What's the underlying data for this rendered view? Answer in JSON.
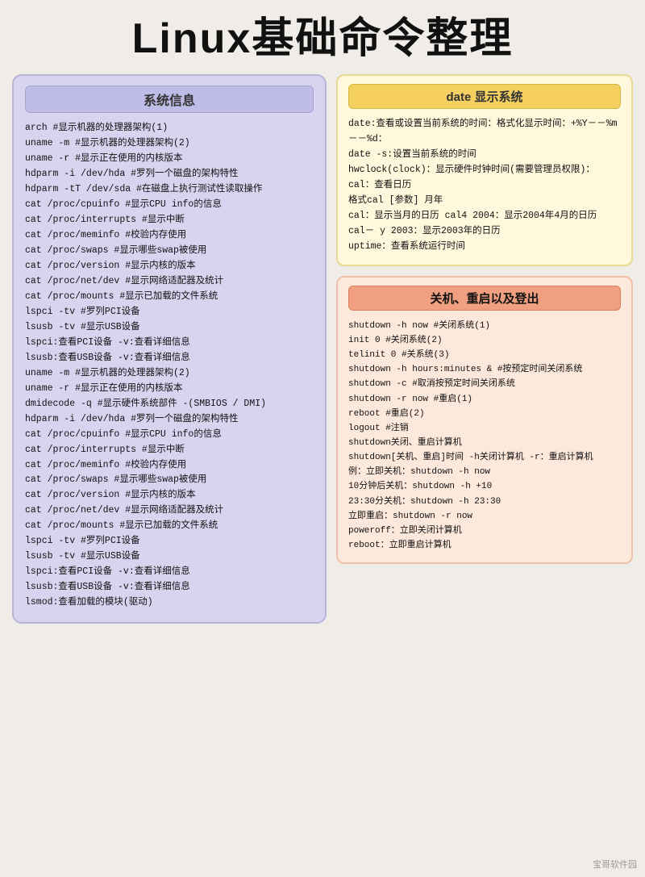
{
  "title": "Linux基础命令整理",
  "left_panel": {
    "header": "系统信息",
    "lines": [
      "arch      #显示机器的处理器架构(1)",
      "uname -m  #显示机器的处理器架构(2)",
      "uname -r  #显示正在使用的内核版本",
      "hdparm -i /dev/hda   #罗列一个磁盘的架构特性",
      "hdparm -tT /dev/sda  #在磁盘上执行测试性读取操作",
      "cat /proc/cpuinfo    #显示CPU info的信息",
      "cat /proc/interrupts #显示中断",
      "cat /proc/meminfo    #校验内存使用",
      "cat /proc/swaps      #显示哪些swap被使用",
      "cat /proc/version    #显示内核的版本",
      "cat /proc/net/dev    #显示网络适配器及统计",
      "cat /proc/mounts     #显示已加载的文件系统",
      "lspci -tv   #罗列PCI设备",
      "lsusb -tv   #显示USB设备",
      "lspci:查看PCI设备  -v:查看详细信息",
      "lsusb:查看USB设备  -v:查看详细信息",
      "uname -m  #显示机器的处理器架构(2)",
      "uname -r  #显示正在使用的内核版本",
      "dmidecode -q       #显示硬件系统部件 -(SMBIOS / DMI)",
      "hdparm -i /dev/hda   #罗列一个磁盘的架构特性",
      "cat /proc/cpuinfo    #显示CPU info的信息",
      "cat /proc/interrupts #显示中断",
      "cat /proc/meminfo    #校验内存使用",
      "cat /proc/swaps      #显示哪些swap被使用",
      "cat /proc/version    #显示内核的版本",
      "cat /proc/net/dev    #显示网络适配器及统计",
      "cat /proc/mounts     #显示已加载的文件系统",
      "lspci -tv   #罗列PCI设备",
      "lsusb -tv   #显示USB设备",
      "lspci:查看PCI设备  -v:查看详细信息",
      "lsusb:查看USB设备  -v:查看详细信息",
      "lsmod:查看加载的模块(驱动)"
    ]
  },
  "date_panel": {
    "header": "date 显示系统",
    "lines": [
      "date:查看或设置当前系统的时间：格式化显示时间：+%Y－－%m－－%d：",
      "date -s:设置当前系统的时间",
      "hwclock(clock)：显示硬件时钟时间(需要管理员权限)：",
      "cal：查看日历",
      "格式cal [参数] 月年",
      "cal：显示当月的日历   cal4 2004：显示2004年4月的日历",
      "cal－ y 2003：显示2003年的日历",
      "uptime：查看系统运行时间"
    ]
  },
  "shutdown_panel": {
    "header": "关机、重启以及登出",
    "lines": [
      "shutdown -h now    #关闭系统(1)",
      "init 0             #关闭系统(2)",
      "telinit 0          #关系统(3)",
      "shutdown -h hours:minutes & #按预定时间关闭系统",
      "shutdown -c        #取消按预定时间关闭系统",
      "shutdown -r now    #重启(1)",
      "reboot    #重启(2)",
      "logout    #注销",
      "shutdown关闭、重启计算机",
      "shutdown[关机、重启]时间  -h关闭计算机  -r：重启计算机",
      "例：立即关机：shutdown -h now",
      "10分钟后关机：shutdown -h +10",
      "23:30分关机：shutdown -h 23:30",
      "立即重启：shutdown -r now",
      "poweroff：立即关闭计算机",
      "reboot：立即重启计算机"
    ]
  },
  "watermark": "宝哥软件园"
}
